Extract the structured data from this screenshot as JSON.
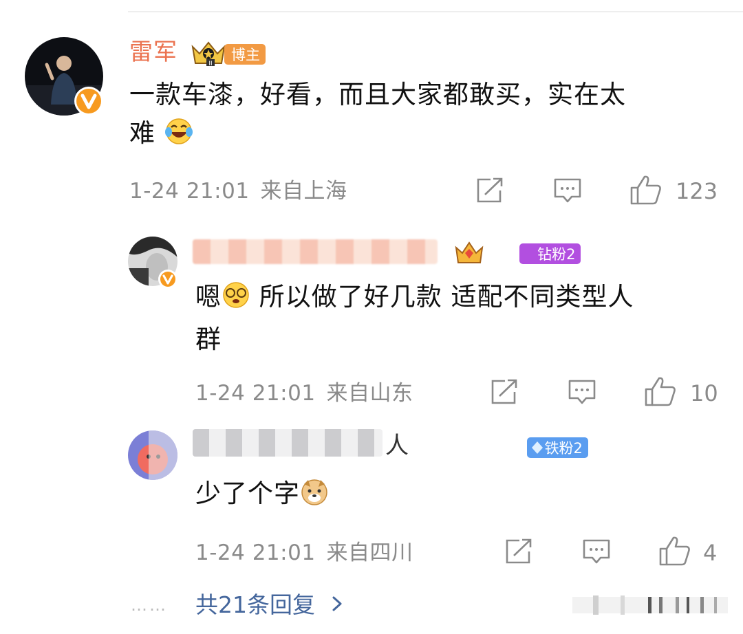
{
  "comments": [
    {
      "name": "雷军",
      "badge": "博主",
      "content_line1": "一款车漆，好看，而且大家都敢买，实在太",
      "content_line2": "难",
      "time": "1-24 21:01",
      "location": "来自上海",
      "likes": "123"
    }
  ],
  "replies": [
    {
      "badge": "钻粉2",
      "content_line1_a": "嗯",
      "content_line1_b": " 所以做了好几款 适配不同类型人",
      "content_line2": "群",
      "time": "1-24 21:01",
      "location": "来自山东",
      "likes": "10"
    },
    {
      "name_suffix": "人",
      "badge": "铁粉2",
      "content": "少了个字",
      "time": "1-24 21:01",
      "location": "来自四川",
      "likes": "4"
    }
  ],
  "more_replies": "共21条回复",
  "dots": "……",
  "colors": {
    "name": "#eb7350",
    "link": "#44669c",
    "verified": "#f79a1f"
  },
  "icons": [
    "verified-badge-icon",
    "share-icon",
    "comment-icon",
    "like-icon",
    "chevron-right-icon",
    "laugh-cry-emoji",
    "dizzy-emoji",
    "doge-emoji"
  ]
}
